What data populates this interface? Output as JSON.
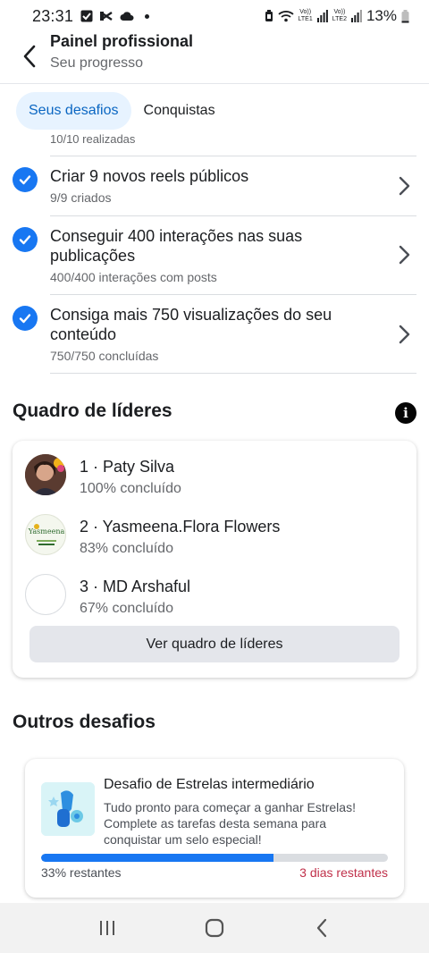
{
  "status_bar": {
    "time": "23:31",
    "battery": "13%",
    "sim1_label_top": "Vo))",
    "sim1_label_bottom": "LTE1",
    "sim2_label_top": "Vo))",
    "sim2_label_bottom": "LTE2"
  },
  "header": {
    "title": "Painel profissional",
    "subtitle": "Seu progresso"
  },
  "tabs": [
    {
      "label": "Seus desafios",
      "active": true
    },
    {
      "label": "Conquistas",
      "active": false
    }
  ],
  "cut_off_text": "10/10 realizadas",
  "challenges": [
    {
      "title": "Criar 9 novos reels públicos",
      "subtitle": "9/9 criados"
    },
    {
      "title": "Conseguir 400 interações nas suas publicações",
      "subtitle": "400/400 interações com posts"
    },
    {
      "title": "Consiga mais 750 visualizações do seu conteúdo",
      "subtitle": "750/750 concluídas"
    }
  ],
  "leaderboard": {
    "title": "Quadro de líderes",
    "entries": [
      {
        "name": "1 · Paty Silva",
        "progress": "100% concluído"
      },
      {
        "name": "2 · Yasmeena.Flora Flowers",
        "progress": "83% concluído",
        "avatar_text": "Yasmeena"
      },
      {
        "name": "3 · MD Arshaful",
        "progress": "67% concluído"
      }
    ],
    "button_label": "Ver quadro de líderes"
  },
  "other_challenges": {
    "title": "Outros desafios",
    "card": {
      "title": "Desafio de Estrelas intermediário",
      "description": "Tudo pronto para começar a ganhar Estrelas! Complete as tarefas desta semana para conquistar um selo especial!",
      "progress_fraction": 0.67,
      "remaining_label": "33% restantes",
      "days_label": "3 dias restantes"
    }
  },
  "colors": {
    "accent": "#1877f2",
    "tab_active_bg": "#e7f3ff",
    "tab_active_text": "#0a66c2",
    "days_remaining": "#c0304a"
  }
}
